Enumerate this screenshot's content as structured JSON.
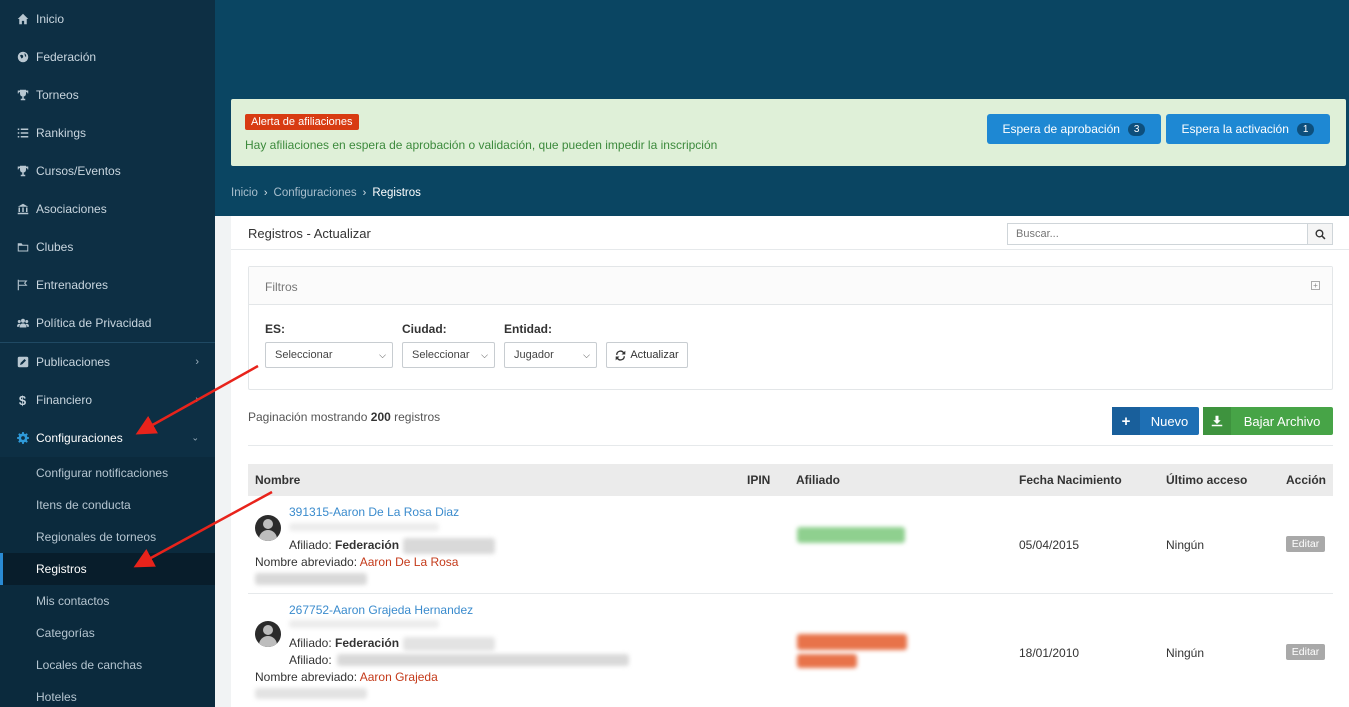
{
  "sidebar": {
    "items": [
      {
        "label": "Inicio",
        "icon": "home-icon"
      },
      {
        "label": "Federación",
        "icon": "globe-icon"
      },
      {
        "label": "Torneos",
        "icon": "trophy-icon"
      },
      {
        "label": "Rankings",
        "icon": "list-icon"
      },
      {
        "label": "Cursos/Eventos",
        "icon": "trophy-icon"
      },
      {
        "label": "Asociaciones",
        "icon": "bank-icon"
      },
      {
        "label": "Clubes",
        "icon": "folder-icon"
      },
      {
        "label": "Entrenadores",
        "icon": "flag-icon"
      },
      {
        "label": "Política de Privacidad",
        "icon": "users-icon"
      },
      {
        "label": "Publicaciones",
        "icon": "edit-icon"
      },
      {
        "label": "Financiero",
        "icon": "dollar-icon"
      },
      {
        "label": "Configuraciones",
        "icon": "gear-icon"
      }
    ],
    "sub_items": [
      {
        "label": "Configurar notificaciones"
      },
      {
        "label": "Itens de conducta"
      },
      {
        "label": "Regionales de torneos"
      },
      {
        "label": "Registros"
      },
      {
        "label": "Mis contactos"
      },
      {
        "label": "Categorías"
      },
      {
        "label": "Locales de canchas"
      },
      {
        "label": "Hoteles"
      }
    ]
  },
  "alert": {
    "badge": "Alerta de afiliaciones",
    "message": "Hay afiliaciones en espera de aprobación o validación, que pueden impedir la inscripción",
    "buttons": [
      {
        "label": "Espera de aprobación",
        "count": "3"
      },
      {
        "label": "Espera la activación",
        "count": "1"
      }
    ]
  },
  "breadcrumb": [
    "Inicio",
    "Configuraciones",
    "Registros"
  ],
  "panel": {
    "title": "Registros - Actualizar",
    "search_placeholder": "Buscar..."
  },
  "filters": {
    "title": "Filtros",
    "toggle": "+",
    "fields": [
      {
        "label": "ES:",
        "value": "Seleccionar"
      },
      {
        "label": "Ciudad:",
        "value": "Seleccionar"
      },
      {
        "label": "Entidad:",
        "value": "Jugador"
      }
    ],
    "refresh_label": "Actualizar"
  },
  "pagination": {
    "prefix": "Paginación mostrando",
    "count": "200",
    "suffix": "registros"
  },
  "actions": {
    "new_label": "Nuevo",
    "download_label": "Bajar Archivo"
  },
  "table": {
    "columns": [
      "Nombre",
      "IPIN",
      "Afiliado",
      "Fecha Nacimiento",
      "Último acceso",
      "Acción"
    ],
    "rows": [
      {
        "name": "391315-Aaron De La Rosa Diaz",
        "affiliated_label": "Afiliado:",
        "affiliated_value": "Federación",
        "abbr_label": "Nombre abreviado:",
        "abbr_value": "Aaron De La Rosa",
        "birth": "05/04/2015",
        "last_access": "Ningún",
        "edit": "Editar",
        "status_color": "#8fd08f"
      },
      {
        "name": "267752-Aaron Grajeda Hernandez",
        "affiliated_label": "Afiliado:",
        "affiliated_value": "Federación",
        "affiliated_label2": "Afiliado:",
        "abbr_label": "Nombre abreviado:",
        "abbr_value": "Aaron Grajeda",
        "birth": "18/01/2010",
        "last_access": "Ningún",
        "edit": "Editar",
        "status_color": "#e8734a"
      }
    ]
  },
  "colors": {
    "sidebar": "#0d2f44",
    "header": "#0a4562",
    "accent": "#1e88d3",
    "annotation_arrow": "#e8231b"
  }
}
